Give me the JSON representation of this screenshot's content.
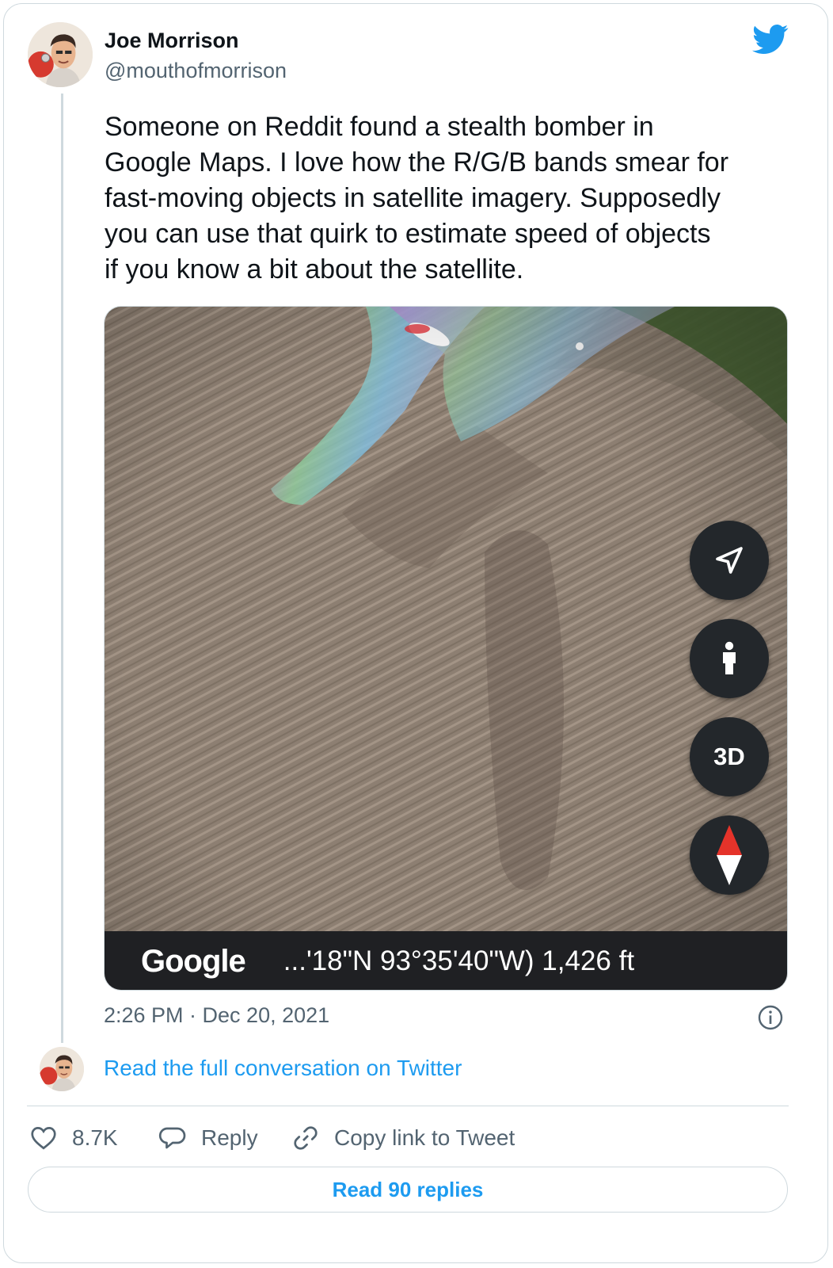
{
  "author": {
    "name": "Joe Morrison",
    "handle": "@mouthofmorrison"
  },
  "tweet": {
    "text": "Someone on Reddit found a stealth bomber in\nGoogle Maps. I love how the R/G/B bands smear for\nfast-moving objects in satellite imagery. Supposedly\nyou can use that quirk to estimate speed of objects\nif you know a bit about the satellite.",
    "timestamp": "2:26 PM · Dec 20, 2021"
  },
  "map": {
    "controls": {
      "navigate_icon": "navigation-arrow-icon",
      "pegman_icon": "street-view-person-icon",
      "three_d_label": "3D",
      "compass_icon": "compass-icon"
    },
    "footer": {
      "logo": "Google",
      "coordinates": "...'18\"N 93°35'40\"W) 1,426 ft"
    }
  },
  "conversation": {
    "link_text": "Read the full conversation on Twitter"
  },
  "actions": {
    "likes": "8.7K",
    "reply_label": "Reply",
    "copy_link_label": "Copy link to Tweet",
    "read_replies_label": "Read 90 replies"
  },
  "colors": {
    "twitter_blue": "#1d9bf0",
    "text_primary": "#0f1419",
    "text_secondary": "#536471",
    "border": "#cfd9de",
    "map_control_bg": "#23272b"
  }
}
